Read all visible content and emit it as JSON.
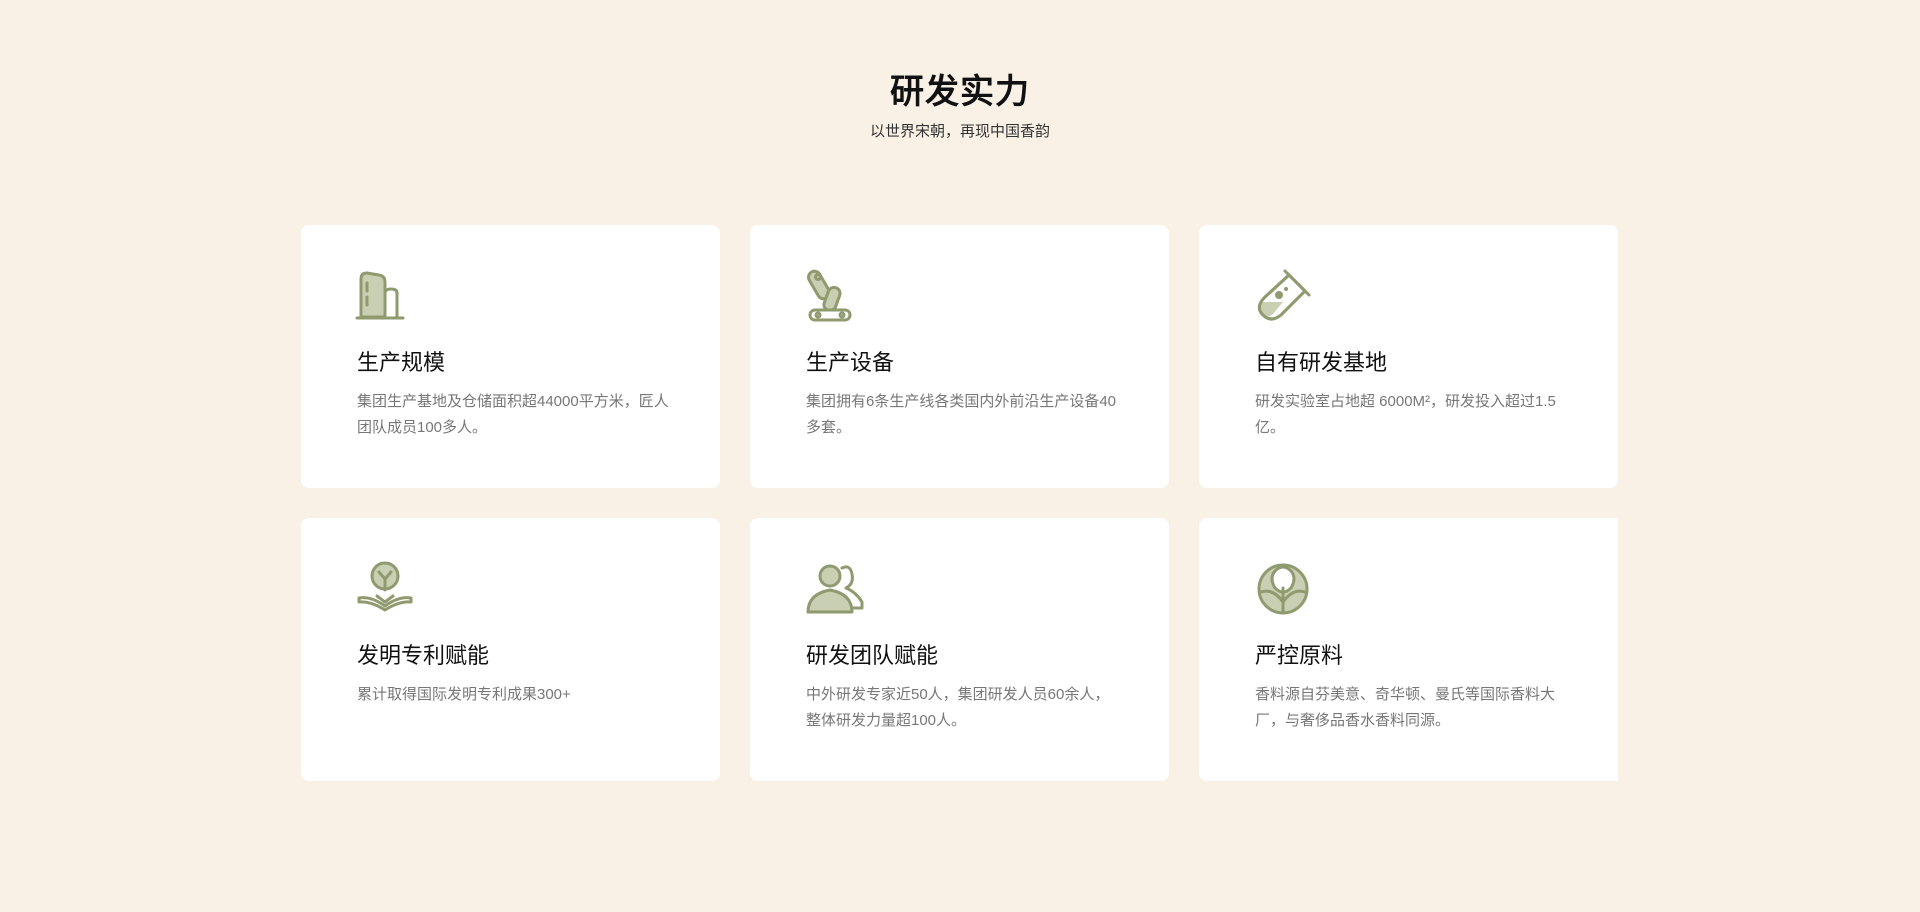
{
  "section": {
    "title": "研发实力",
    "subtitle": "以世界宋朝，再现中国香韵"
  },
  "theme": {
    "background": "#f9f1e6",
    "card_background": "#ffffff",
    "icon_color": "#8f9a6f",
    "icon_fill": "#c8cfb2"
  },
  "cards": [
    {
      "icon": "factory-buildings-icon",
      "title": "生产规模",
      "desc": "集团生产基地及仓储面积超44000平方米，匠人团队成员100多人。"
    },
    {
      "icon": "robot-arm-icon",
      "title": "生产设备",
      "desc": "集团拥有6条生产线各类国内外前沿生产设备40多套。"
    },
    {
      "icon": "test-tube-icon",
      "title": "自有研发基地",
      "desc": "研发实验室占地超 6000M²，研发投入超过1.5亿。"
    },
    {
      "icon": "lightbulb-in-hand-icon",
      "title": "发明专利赋能",
      "desc": "累计取得国际发明专利成果300+"
    },
    {
      "icon": "team-people-icon",
      "title": "研发团队赋能",
      "desc": "中外研发专家近50人，集团研发人员60余人，整体研发力量超100人。"
    },
    {
      "icon": "cabbage-leaf-icon",
      "title": "严控原料",
      "desc": "香料源自芬美意、奇华顿、曼氏等国际香料大厂，与奢侈品香水香料同源。"
    }
  ]
}
